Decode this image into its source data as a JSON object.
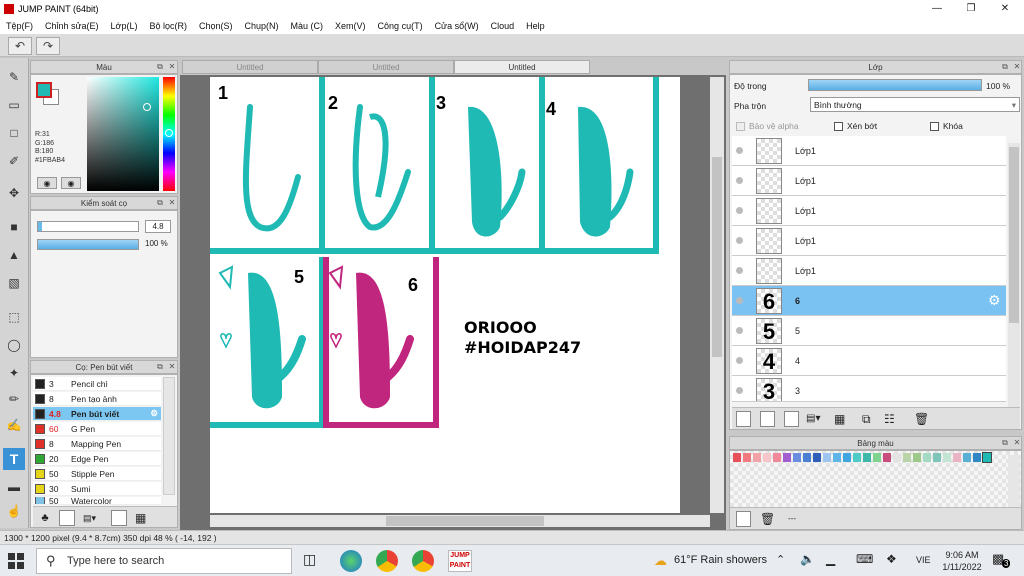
{
  "window": {
    "title": "JUMP PAINT (64bit)"
  },
  "menu": [
    "Tệp(F)",
    "Chỉnh sửa(E)",
    "Lớp(L)",
    "Bộ lọc(R)",
    "Chọn(S)",
    "Chụp(N)",
    "Màu (C)",
    "Xem(V)",
    "Công cụ(T)",
    "Cửa sổ(W)",
    "Cloud",
    "Help"
  ],
  "color_panel": {
    "title": "Màu",
    "r": "R:31",
    "g": "G:186",
    "b": "B:180",
    "hex": "#1FBAB4",
    "current_color": "#1fbab4"
  },
  "brush_control": {
    "title": "Kiểm soát cọ",
    "size": "4.8",
    "opacity": "100 %"
  },
  "brush_list": {
    "title": "Cọ: Pen bút viết",
    "items": [
      {
        "color": "#222222",
        "size": "3",
        "name": "Pencil chì"
      },
      {
        "color": "#222222",
        "size": "8",
        "name": "Pen tạo ảnh"
      },
      {
        "color": "#222222",
        "size": "4.8",
        "name": "Pen bút viết",
        "selected": true
      },
      {
        "color": "#e0302a",
        "size": "60",
        "name": "G Pen"
      },
      {
        "color": "#e0302a",
        "size": "8",
        "name": "Mapping Pen"
      },
      {
        "color": "#2ea832",
        "size": "20",
        "name": "Edge Pen"
      },
      {
        "color": "#e6d41a",
        "size": "50",
        "name": "Stipple Pen"
      },
      {
        "color": "#e6d41a",
        "size": "30",
        "name": "Sumi"
      },
      {
        "color": "#7fc4e6",
        "size": "50",
        "name": "Watercolor"
      }
    ]
  },
  "tabs": [
    "Untitled",
    "Untitled",
    "Untitled"
  ],
  "canvas": {
    "watermark_line1": "ORIOOO",
    "watermark_line2": "#HOIDAP247",
    "panel_numbers": [
      "1",
      "2",
      "3",
      "4",
      "5",
      "6"
    ]
  },
  "layer_panel": {
    "title": "Lớp",
    "opacity_label": "Độ trong",
    "opacity_value": "100 %",
    "opacity_level": 1.0,
    "blend_label": "Pha trộn",
    "blend_value": "Bình thường",
    "protect_alpha": "Bảo vệ alpha",
    "clipping": "Xén bớt",
    "lock": "Khóa",
    "layers": [
      {
        "name": "Lớp1",
        "thumb": ""
      },
      {
        "name": "Lớp1",
        "thumb": ""
      },
      {
        "name": "Lớp1",
        "thumb": ""
      },
      {
        "name": "Lớp1",
        "thumb": ""
      },
      {
        "name": "Lớp1",
        "thumb": ""
      },
      {
        "name": "6",
        "thumb": "6",
        "selected": true
      },
      {
        "name": "5",
        "thumb": "5"
      },
      {
        "name": "4",
        "thumb": "4"
      },
      {
        "name": "3",
        "thumb": "3"
      }
    ]
  },
  "palette_panel": {
    "title": "Bảng màu",
    "info": "---"
  },
  "status": {
    "text": "1300 * 1200 pixel   (9.4 * 8.7cm)   350 dpi   48 %   ( -14, 192 )"
  },
  "taskbar": {
    "search_placeholder": "Type here to search",
    "weather": "61°F  Rain showers",
    "lang": "VIE",
    "time": "9:06 AM",
    "date": "1/11/2022",
    "notif_count": "3"
  }
}
